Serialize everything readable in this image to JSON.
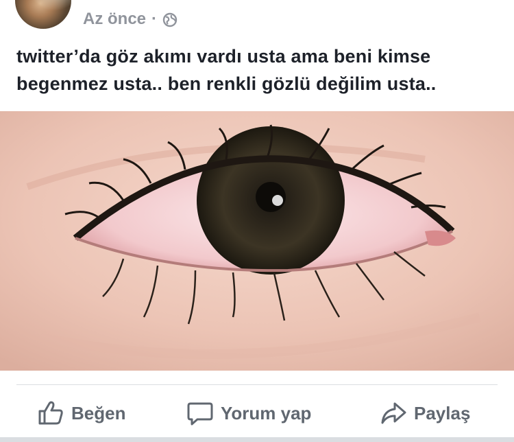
{
  "post": {
    "timestamp": "Az önce",
    "separator": "·",
    "privacy_icon": "globe-icon",
    "text_line1": "twitter’da göz akımı vardı usta ama beni kimse",
    "text_line2": "begenmez usta.. ben renkli gözlü değilim usta..",
    "photo_icon": "eye-photo"
  },
  "actions": {
    "like_label": "Beğen",
    "comment_label": "Yorum yap",
    "share_label": "Paylaş"
  },
  "colors": {
    "text": "#1d2129",
    "muted": "#90949c",
    "action": "#606770",
    "divider": "#dadde1"
  }
}
